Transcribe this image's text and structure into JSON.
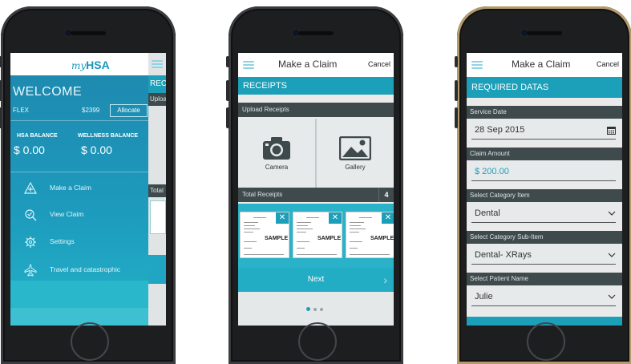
{
  "phone1": {
    "logo_my": "my",
    "logo_hsa": "HSA",
    "welcome": "WELCOME",
    "flex_label": "FLEX",
    "flex_amount": "$2399",
    "allocate_label": "Allocate",
    "hsa_balance_label": "HSA BALANCE",
    "hsa_balance_value": "$ 0.00",
    "wellness_balance_label": "WELLNESS BALANCE",
    "wellness_balance_value": "$ 0.00",
    "menu": [
      {
        "label": "Make a Claim",
        "icon": "plus-triangle-icon"
      },
      {
        "label": "View Claim",
        "icon": "magnifier-check-icon"
      },
      {
        "label": "Settings",
        "icon": "gear-icon"
      },
      {
        "label": "Travel and catastrophic",
        "icon": "airplane-icon"
      }
    ],
    "side_panel": {
      "header": "RECEIPTS",
      "upload": "Upload Receipts",
      "total": "Total Receipts"
    }
  },
  "phone2": {
    "title": "Make a Claim",
    "cancel": "Cancel",
    "section": "RECEIPTS",
    "upload_label": "Upload Receipts",
    "camera_label": "Camera",
    "gallery_label": "Gallery",
    "total_label": "Total Receipts",
    "total_count": "4",
    "sample_label": "SAMPLE",
    "next_label": "Next"
  },
  "phone3": {
    "title": "Make a Claim",
    "cancel": "Cancel",
    "section": "REQUIRED DATAS",
    "fields": [
      {
        "label": "Service Date",
        "value": "28 Sep 2015",
        "control": "calendar-icon"
      },
      {
        "label": "Claim Amount",
        "value": "$ 200.00",
        "control": "none"
      },
      {
        "label": "Select Category Item",
        "value": "Dental",
        "control": "chevron-down-icon"
      },
      {
        "label": "Select Category Sub-Item",
        "value": "Dental- XRays",
        "control": "chevron-down-icon"
      },
      {
        "label": "Select Patient Name",
        "value": "Julie",
        "control": "chevron-down-icon"
      }
    ]
  },
  "colors": {
    "teal": "#1c9fb9",
    "dark_bar": "#3f4a4d",
    "phone_body": "#1d1e20",
    "field_bg": "#e7eaeb"
  }
}
